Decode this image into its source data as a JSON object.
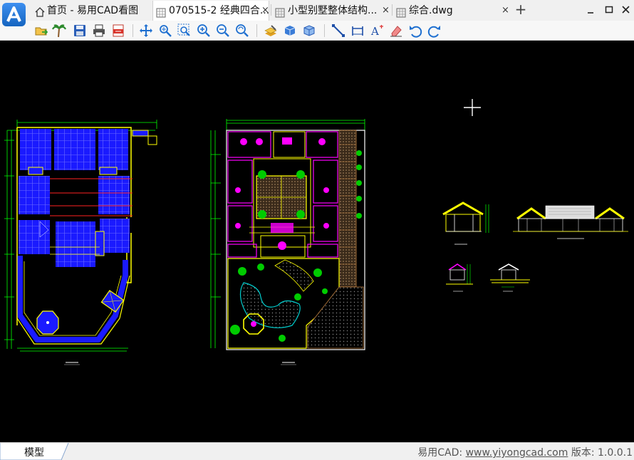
{
  "tabs": [
    {
      "label": "首页 - 易用CAD看图",
      "icon": "home-icon",
      "active": false,
      "closable": false
    },
    {
      "label": "070515-2 经典四合...",
      "icon": "drawing-file-icon",
      "active": true,
      "closable": true
    },
    {
      "label": "小型别墅整体结构...",
      "icon": "drawing-file-icon",
      "active": false,
      "closable": true
    },
    {
      "label": "综合.dwg",
      "icon": "drawing-file-icon",
      "active": false,
      "closable": true
    }
  ],
  "new_tab_symbol": "+",
  "tab_close_symbol": "×",
  "toolbar_icons": [
    "open-file-icon",
    "palm-tree-icon",
    "save-icon",
    "print-icon",
    "export-pdf-icon",
    "pan-icon",
    "zoom-realtime-icon",
    "zoom-window-icon",
    "zoom-in-icon",
    "zoom-out-icon",
    "zoom-extents-icon",
    "layer-icon",
    "3d-box-icon",
    "3d-view-icon",
    "line-measure-icon",
    "dimension-icon",
    "text-icon",
    "eraser-icon",
    "undo-icon",
    "redo-icon"
  ],
  "status": {
    "model_tab": "模型",
    "prefix": "易用CAD: ",
    "link": "www.yiyongcad.com",
    "version": " 版本: 1.0.0.1"
  },
  "colors": {
    "accent": "#1976d2",
    "canvas_bg": "#000000",
    "cad_blue": "#1a1aff",
    "cad_yellow": "#ffff00",
    "cad_green": "#00ff00",
    "cad_magenta": "#ff00ff",
    "cad_white": "#ffffff"
  }
}
